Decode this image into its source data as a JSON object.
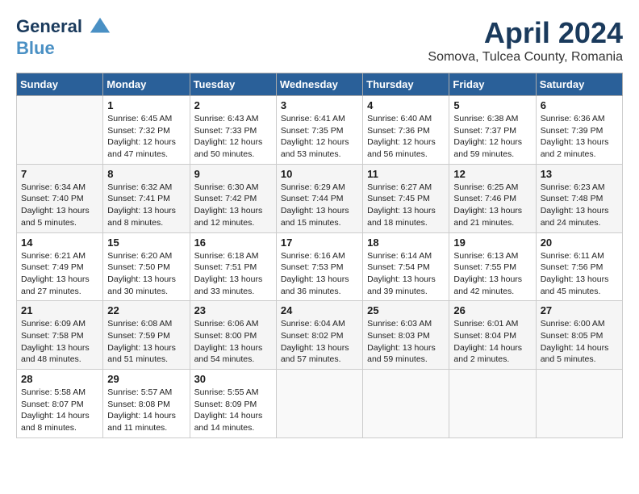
{
  "header": {
    "logo_line1": "General",
    "logo_line2": "Blue",
    "title": "April 2024",
    "subtitle": "Somova, Tulcea County, Romania"
  },
  "calendar": {
    "weekdays": [
      "Sunday",
      "Monday",
      "Tuesday",
      "Wednesday",
      "Thursday",
      "Friday",
      "Saturday"
    ],
    "weeks": [
      [
        {
          "day": "",
          "content": ""
        },
        {
          "day": "1",
          "content": "Sunrise: 6:45 AM\nSunset: 7:32 PM\nDaylight: 12 hours\nand 47 minutes."
        },
        {
          "day": "2",
          "content": "Sunrise: 6:43 AM\nSunset: 7:33 PM\nDaylight: 12 hours\nand 50 minutes."
        },
        {
          "day": "3",
          "content": "Sunrise: 6:41 AM\nSunset: 7:35 PM\nDaylight: 12 hours\nand 53 minutes."
        },
        {
          "day": "4",
          "content": "Sunrise: 6:40 AM\nSunset: 7:36 PM\nDaylight: 12 hours\nand 56 minutes."
        },
        {
          "day": "5",
          "content": "Sunrise: 6:38 AM\nSunset: 7:37 PM\nDaylight: 12 hours\nand 59 minutes."
        },
        {
          "day": "6",
          "content": "Sunrise: 6:36 AM\nSunset: 7:39 PM\nDaylight: 13 hours\nand 2 minutes."
        }
      ],
      [
        {
          "day": "7",
          "content": "Sunrise: 6:34 AM\nSunset: 7:40 PM\nDaylight: 13 hours\nand 5 minutes."
        },
        {
          "day": "8",
          "content": "Sunrise: 6:32 AM\nSunset: 7:41 PM\nDaylight: 13 hours\nand 8 minutes."
        },
        {
          "day": "9",
          "content": "Sunrise: 6:30 AM\nSunset: 7:42 PM\nDaylight: 13 hours\nand 12 minutes."
        },
        {
          "day": "10",
          "content": "Sunrise: 6:29 AM\nSunset: 7:44 PM\nDaylight: 13 hours\nand 15 minutes."
        },
        {
          "day": "11",
          "content": "Sunrise: 6:27 AM\nSunset: 7:45 PM\nDaylight: 13 hours\nand 18 minutes."
        },
        {
          "day": "12",
          "content": "Sunrise: 6:25 AM\nSunset: 7:46 PM\nDaylight: 13 hours\nand 21 minutes."
        },
        {
          "day": "13",
          "content": "Sunrise: 6:23 AM\nSunset: 7:48 PM\nDaylight: 13 hours\nand 24 minutes."
        }
      ],
      [
        {
          "day": "14",
          "content": "Sunrise: 6:21 AM\nSunset: 7:49 PM\nDaylight: 13 hours\nand 27 minutes."
        },
        {
          "day": "15",
          "content": "Sunrise: 6:20 AM\nSunset: 7:50 PM\nDaylight: 13 hours\nand 30 minutes."
        },
        {
          "day": "16",
          "content": "Sunrise: 6:18 AM\nSunset: 7:51 PM\nDaylight: 13 hours\nand 33 minutes."
        },
        {
          "day": "17",
          "content": "Sunrise: 6:16 AM\nSunset: 7:53 PM\nDaylight: 13 hours\nand 36 minutes."
        },
        {
          "day": "18",
          "content": "Sunrise: 6:14 AM\nSunset: 7:54 PM\nDaylight: 13 hours\nand 39 minutes."
        },
        {
          "day": "19",
          "content": "Sunrise: 6:13 AM\nSunset: 7:55 PM\nDaylight: 13 hours\nand 42 minutes."
        },
        {
          "day": "20",
          "content": "Sunrise: 6:11 AM\nSunset: 7:56 PM\nDaylight: 13 hours\nand 45 minutes."
        }
      ],
      [
        {
          "day": "21",
          "content": "Sunrise: 6:09 AM\nSunset: 7:58 PM\nDaylight: 13 hours\nand 48 minutes."
        },
        {
          "day": "22",
          "content": "Sunrise: 6:08 AM\nSunset: 7:59 PM\nDaylight: 13 hours\nand 51 minutes."
        },
        {
          "day": "23",
          "content": "Sunrise: 6:06 AM\nSunset: 8:00 PM\nDaylight: 13 hours\nand 54 minutes."
        },
        {
          "day": "24",
          "content": "Sunrise: 6:04 AM\nSunset: 8:02 PM\nDaylight: 13 hours\nand 57 minutes."
        },
        {
          "day": "25",
          "content": "Sunrise: 6:03 AM\nSunset: 8:03 PM\nDaylight: 13 hours\nand 59 minutes."
        },
        {
          "day": "26",
          "content": "Sunrise: 6:01 AM\nSunset: 8:04 PM\nDaylight: 14 hours\nand 2 minutes."
        },
        {
          "day": "27",
          "content": "Sunrise: 6:00 AM\nSunset: 8:05 PM\nDaylight: 14 hours\nand 5 minutes."
        }
      ],
      [
        {
          "day": "28",
          "content": "Sunrise: 5:58 AM\nSunset: 8:07 PM\nDaylight: 14 hours\nand 8 minutes."
        },
        {
          "day": "29",
          "content": "Sunrise: 5:57 AM\nSunset: 8:08 PM\nDaylight: 14 hours\nand 11 minutes."
        },
        {
          "day": "30",
          "content": "Sunrise: 5:55 AM\nSunset: 8:09 PM\nDaylight: 14 hours\nand 14 minutes."
        },
        {
          "day": "",
          "content": ""
        },
        {
          "day": "",
          "content": ""
        },
        {
          "day": "",
          "content": ""
        },
        {
          "day": "",
          "content": ""
        }
      ]
    ]
  }
}
